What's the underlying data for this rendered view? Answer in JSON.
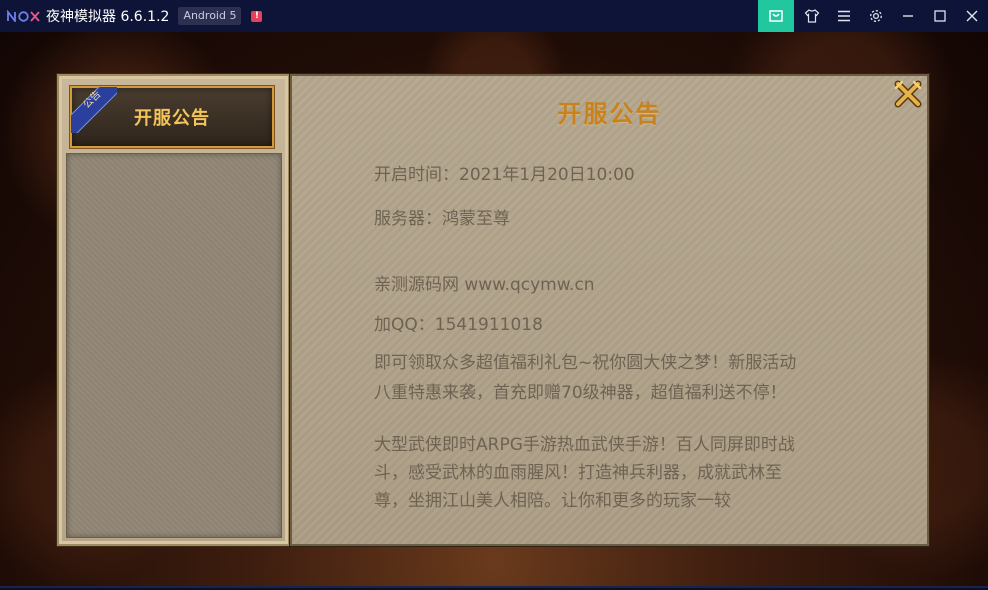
{
  "window": {
    "app_title": "夜神模拟器 6.6.1.2",
    "android_badge": "Android 5",
    "alert_mark": "!",
    "logo_text": "nox"
  },
  "toolbar": {
    "icons": [
      "store-icon",
      "shirt-icon",
      "menu-icon",
      "gear-icon",
      "minimize-icon",
      "maximize-icon",
      "close-icon"
    ],
    "accent_color": "#22c7a0"
  },
  "dialog": {
    "tab": {
      "label": "开服公告",
      "corner_ribbon": "公告"
    },
    "title": "开服公告",
    "lines": {
      "open_time": "开启时间：2021年1月20日10:00",
      "server": "服务器：鸿蒙至尊",
      "site": "亲测源码网 www.qcymw.cn",
      "qq": "加QQ：1541911018",
      "promo_1": "即可领取众多超值福利礼包~祝你圆大侠之梦！新服活动",
      "promo_2": "八重特惠来袭，首充即赠70级神器，超值福利送不停！",
      "desc_1": "大型武侠即时ARPG手游热血武侠手游！百人同屏即时战",
      "desc_2": "斗，感受武林的血雨腥风！打造神兵利器，成就武林至",
      "desc_3": "尊，坐拥江山美人相陪。让你和更多的玩家一较"
    },
    "title_color": "#c9811c",
    "text_color": "#6e6253"
  }
}
